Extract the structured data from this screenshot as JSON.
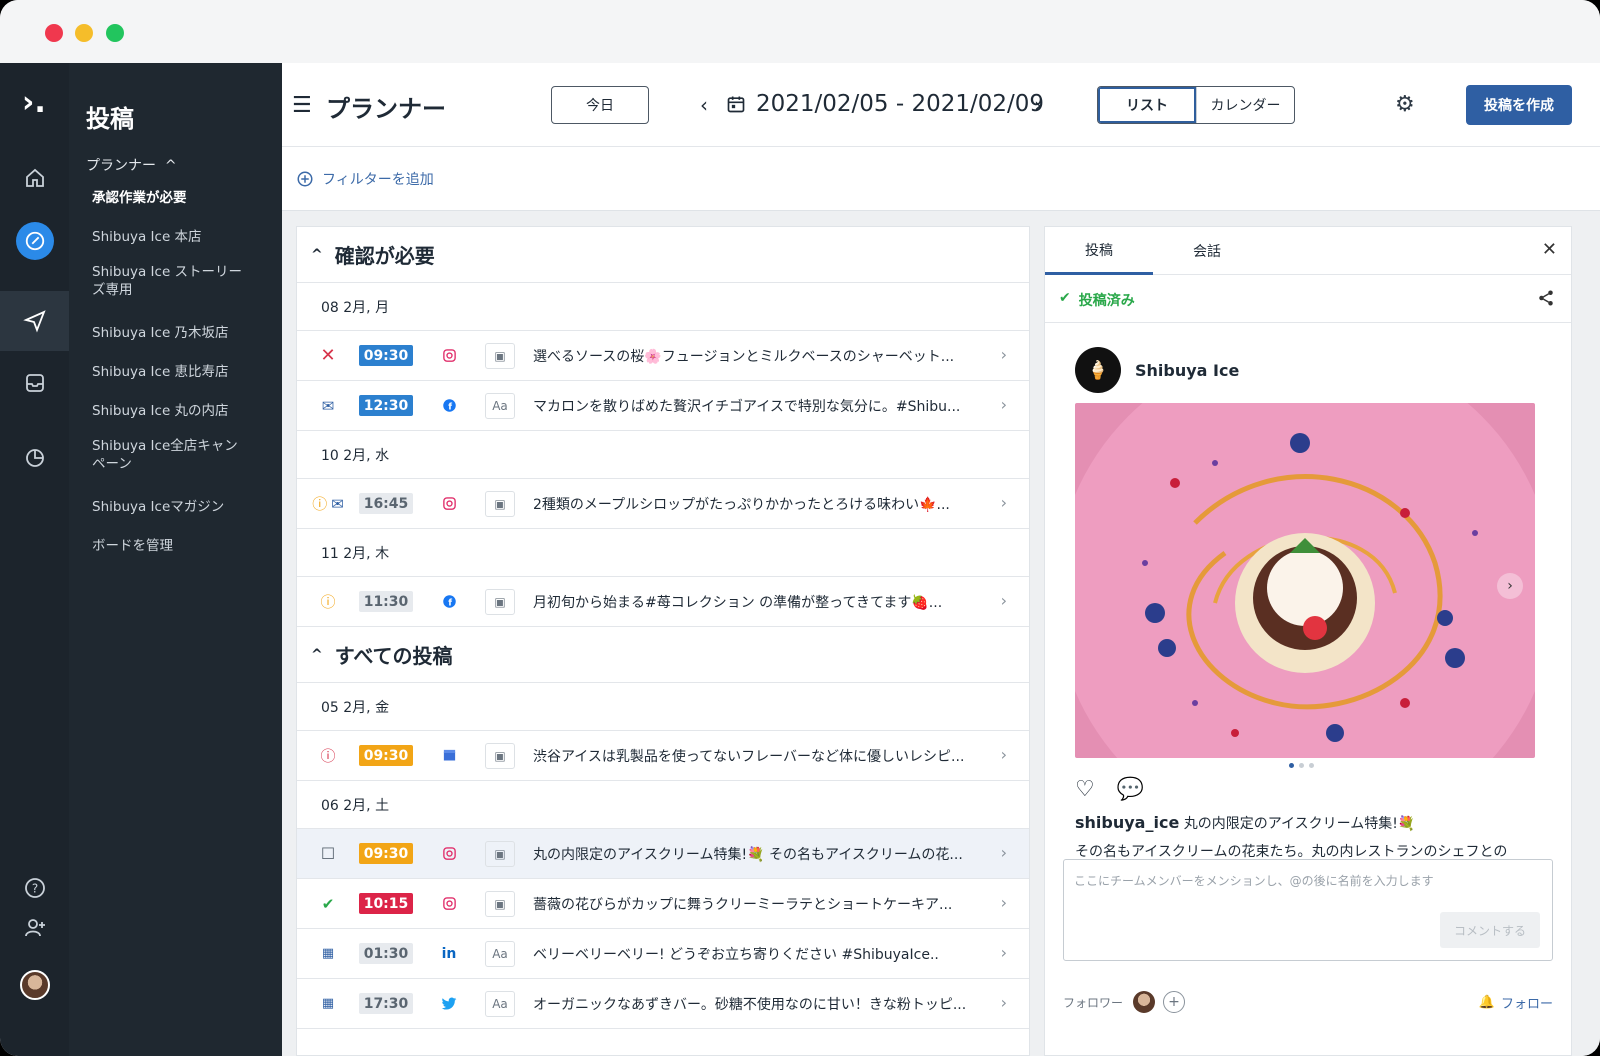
{
  "rail": {
    "logo": "›.",
    "icons": [
      "home-icon",
      "compose-icon",
      "send-icon",
      "inbox-icon",
      "analytics-icon",
      "help-icon",
      "add-user-icon"
    ]
  },
  "sidebar": {
    "heading": "投稿",
    "group_label": "プランナー",
    "group_caret": "^",
    "items": [
      "承認作業が必要",
      "Shibuya Ice 本店",
      "Shibuya Ice ストーリーズ専用",
      "Shibuya Ice 乃木坂店",
      "Shibuya Ice 恵比寿店",
      "Shibuya Ice 丸の内店",
      "Shibuya Ice全店キャンペーン",
      "Shibuya Iceマガジン",
      "ボードを管理"
    ]
  },
  "topbar": {
    "title": "プランナー",
    "today_label": "今日",
    "date_range": "2021/02/05 - 2021/02/09",
    "view_list": "リスト",
    "view_calendar": "カレンダー",
    "create_label": "投稿を作成"
  },
  "filter": {
    "add_label": "フィルターを追加"
  },
  "sections": {
    "needs_review": "確認が必要",
    "all_posts": "すべての投稿"
  },
  "days": {
    "d1": "08 2月, 月",
    "d2": "10 2月, 水",
    "d3": "11 2月, 木",
    "d4": "05 2月, 金",
    "d5": "06 2月, 土"
  },
  "posts": [
    {
      "time": "09:30",
      "text": "選べるソースの桜🌸フュージョンとミルクベースのシャーベット..."
    },
    {
      "time": "12:30",
      "kind": "Aa",
      "text": "マカロンを散りばめた贅沢イチゴアイスで特別な気分に。#Shibu..."
    },
    {
      "time": "16:45",
      "text": "2種類のメープルシロップがたっぷりかかったとろける味わい🍁..."
    },
    {
      "time": "11:30",
      "text": "月初旬から始まる#苺コレクション の準備が整ってきてます🍓..."
    },
    {
      "time": "09:30",
      "text": "渋谷アイスは乳製品を使ってないフレーバーなど体に優しいレシピ..."
    },
    {
      "time": "09:30",
      "text": "丸の内限定のアイスクリーム特集!💐 その名もアイスクリームの花..."
    },
    {
      "time": "10:15",
      "text": "薔薇の花びらがカップに舞うクリーミーラテとショートケーキア..."
    },
    {
      "time": "01:30",
      "net": "in",
      "kind": "Aa",
      "text": "ベリーベリーベリー! どうぞお立ち寄りください #ShibuyaIce.."
    },
    {
      "time": "17:30",
      "kind": "Aa",
      "text": "オーガニックなあずきバー。砂糖不使用なのに甘い！きな粉トッピ..."
    }
  ],
  "detail": {
    "tab_post": "投稿",
    "tab_conversation": "会話",
    "status": "投稿済み",
    "account_name": "Shibuya Ice",
    "caption_user": "shibuya_ice",
    "caption_line1": "丸の内限定のアイスクリーム特集!💐",
    "caption_line2": "その名もアイスクリームの花束たち。丸の内レストランのシェフとの",
    "comment_placeholder": "ここにチームメンバーをメンションし、@の後に名前を入力します",
    "comment_button": "コメントする",
    "followers_label": "フォロワー",
    "follow_label": "フォロー"
  },
  "colors": {
    "accent": "#2f5fa3",
    "time_blue": "#2c80cf",
    "time_orange": "#f2a516",
    "time_red": "#dc2448",
    "posted_green": "#2aa84a",
    "plate_pink": "#e889b0"
  }
}
